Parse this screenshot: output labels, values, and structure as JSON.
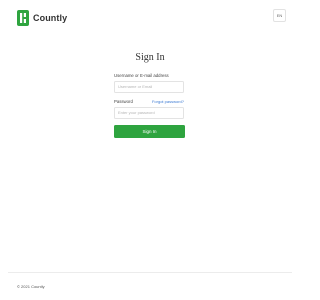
{
  "header": {
    "brand_name": "Countly",
    "logo_icon": "countly-logo-icon",
    "lang_icon": "language-icon",
    "lang_label": "EN"
  },
  "main": {
    "title": "Sign In",
    "username_label": "Username or E-mail address",
    "username_placeholder": "Username or Email",
    "password_label": "Password",
    "forgot_link": "Forgot password?",
    "password_placeholder": "Enter your password",
    "signin_button": "Sign In"
  },
  "footer": {
    "copyright": "© 2021 Countly"
  },
  "colors": {
    "brand_green": "#2ea43f",
    "link_blue": "#3d7bd3"
  }
}
